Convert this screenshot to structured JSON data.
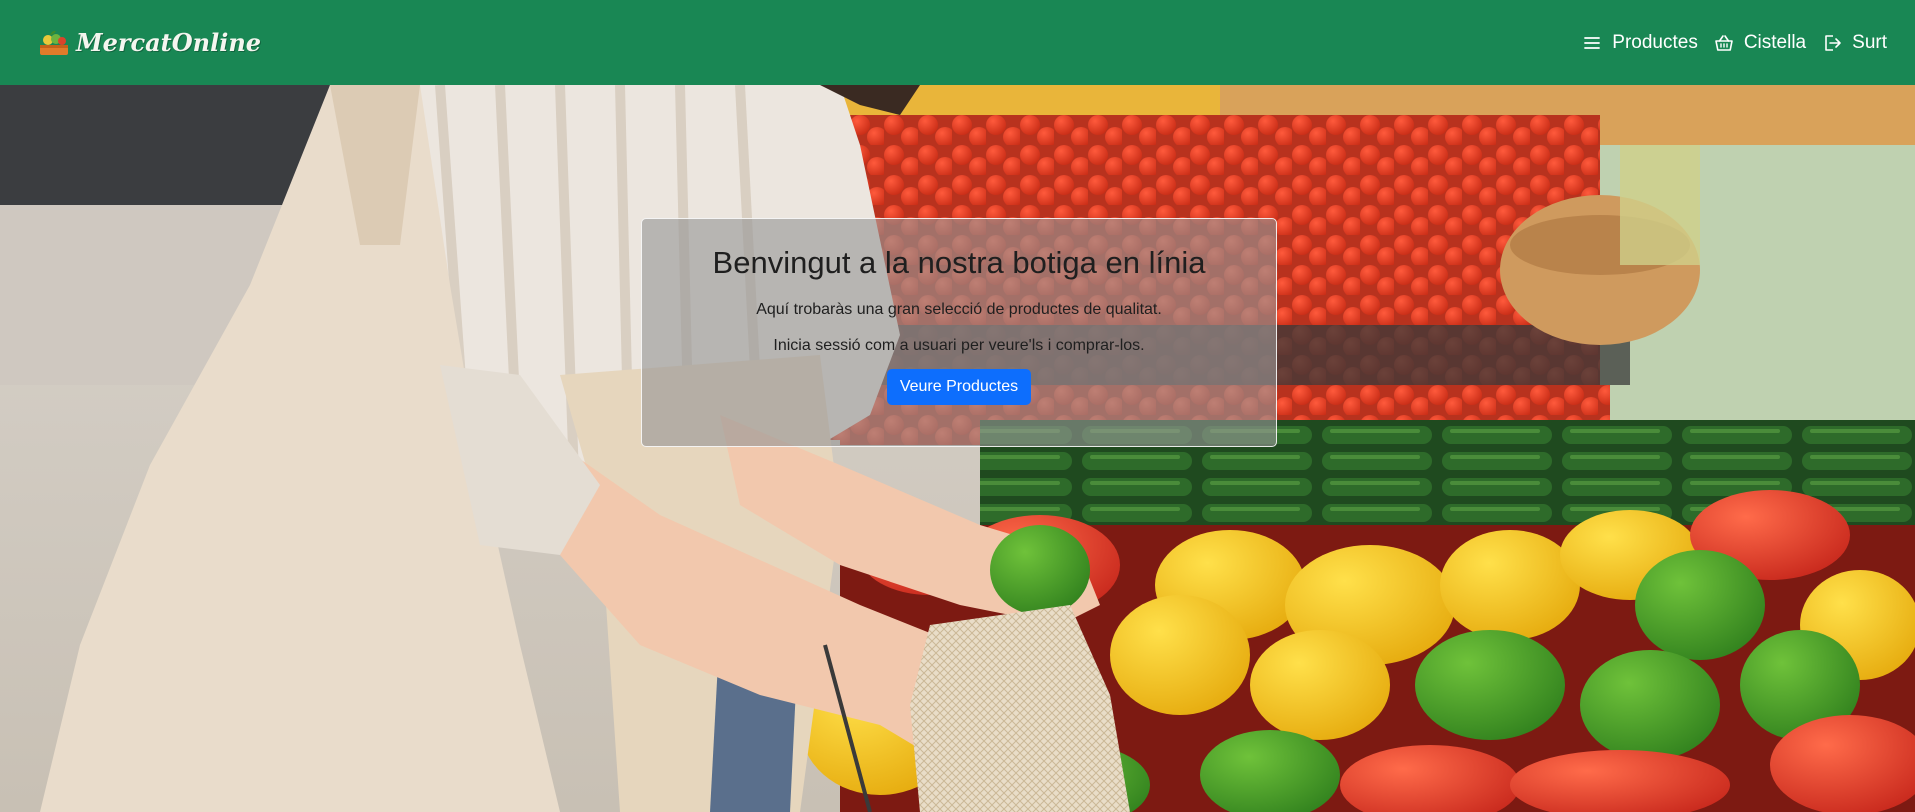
{
  "header": {
    "brand_name": "MercatOnline",
    "brand_logo": "basket-logo",
    "nav": [
      {
        "label": "Productes",
        "icon": "list-icon"
      },
      {
        "label": "Cistella",
        "icon": "basket-icon"
      },
      {
        "label": "Surt",
        "icon": "logout-icon"
      }
    ]
  },
  "hero": {
    "title": "Benvingut a la nostra botiga en línia",
    "line1": "Aquí trobaràs una gran selecció de productes de qualitat.",
    "line2": "Inicia sessió com a usuari per veure'ls i comprar-los.",
    "button_label": "Veure Productes",
    "background_image": "woman-shopping-vegetables-photo"
  },
  "colors": {
    "navbar": "#198754",
    "button": "#0d6efd"
  }
}
